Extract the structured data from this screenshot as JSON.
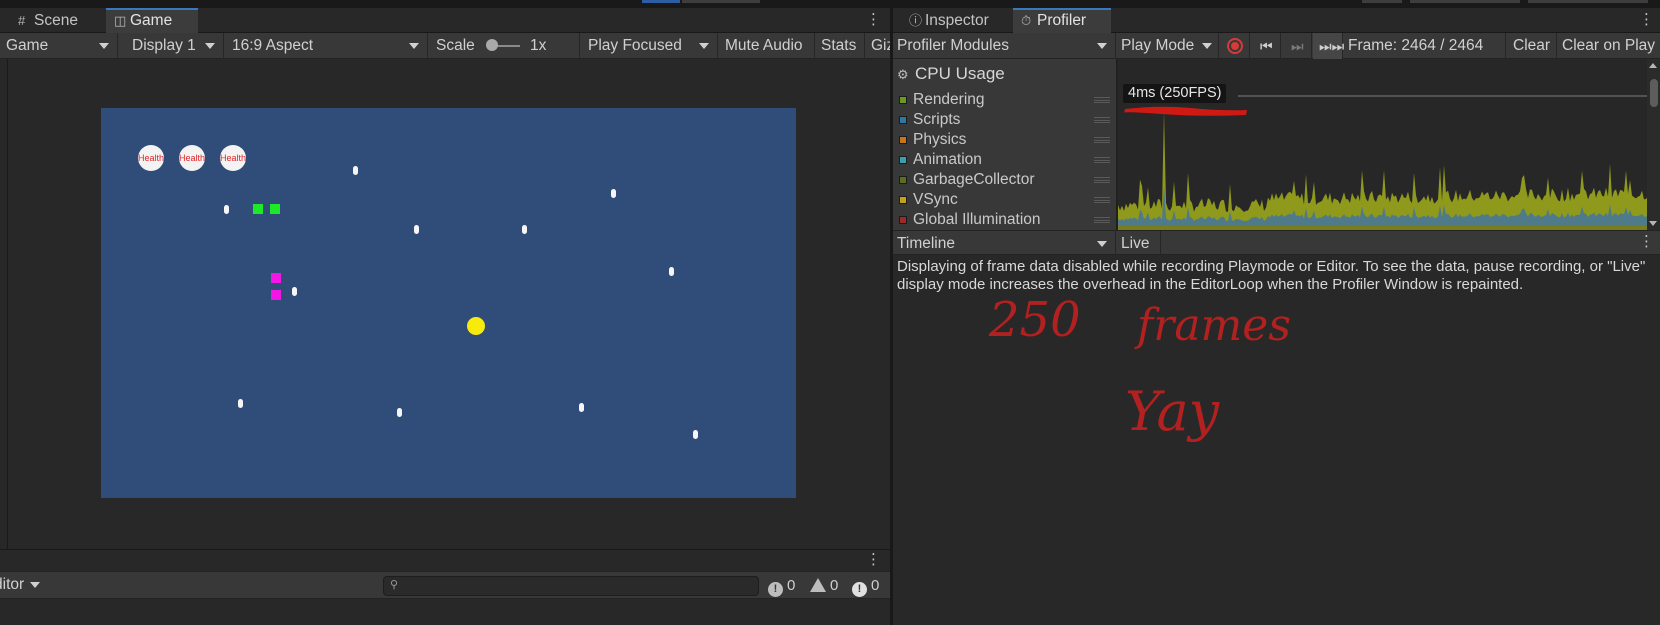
{
  "left_panel": {
    "tabs": [
      {
        "label": "Scene",
        "icon": "grid-icon"
      },
      {
        "label": "Game",
        "icon": "gamepad-icon"
      }
    ],
    "toolbar": {
      "view": "Game",
      "display": "Display 1",
      "aspect": "16:9 Aspect",
      "scale_label": "Scale",
      "scale_value": "1x",
      "play_mode": "Play Focused",
      "mute": "Mute Audio",
      "stats": "Stats",
      "gizmos": "Giz"
    },
    "game": {
      "health_label": "Health",
      "health_count": 3,
      "background_color": "#2f4d78",
      "player_color": "#f7ea0c"
    }
  },
  "console": {
    "dropdown": "ditor",
    "search_placeholder": "",
    "errors": "0",
    "warnings": "0",
    "messages": "0"
  },
  "right_panel": {
    "tabs": [
      {
        "label": "Inspector",
        "icon": "info-icon"
      },
      {
        "label": "Profiler",
        "icon": "profiler-icon"
      }
    ],
    "toolbar": {
      "modules": "Profiler Modules",
      "mode": "Play Mode",
      "frame": "Frame: 2464 / 2464",
      "clear": "Clear",
      "clear_on_play": "Clear on Play"
    },
    "cpu": {
      "title": "CPU Usage",
      "fps_label": "4ms (250FPS)",
      "modules": [
        {
          "name": "Rendering",
          "color": "#6a9a1f"
        },
        {
          "name": "Scripts",
          "color": "#2e78a9"
        },
        {
          "name": "Physics",
          "color": "#c7741d"
        },
        {
          "name": "Animation",
          "color": "#3aa0b0"
        },
        {
          "name": "GarbageCollector",
          "color": "#5a6e1c"
        },
        {
          "name": "VSync",
          "color": "#c0a51a"
        },
        {
          "name": "Global Illumination",
          "color": "#9b2b2b"
        }
      ]
    },
    "timeline": {
      "view": "Timeline",
      "mode": "Live"
    },
    "message": "Displaying of frame data disabled while recording Playmode or Editor. To see the data, pause recording, or \"Live\" display mode increases the overhead in the EditorLoop when the Profiler Window is repainted.",
    "annotation": {
      "line1_a": "250",
      "line1_b": "frames",
      "line2": "Yay",
      "color": "#b2211f"
    }
  }
}
